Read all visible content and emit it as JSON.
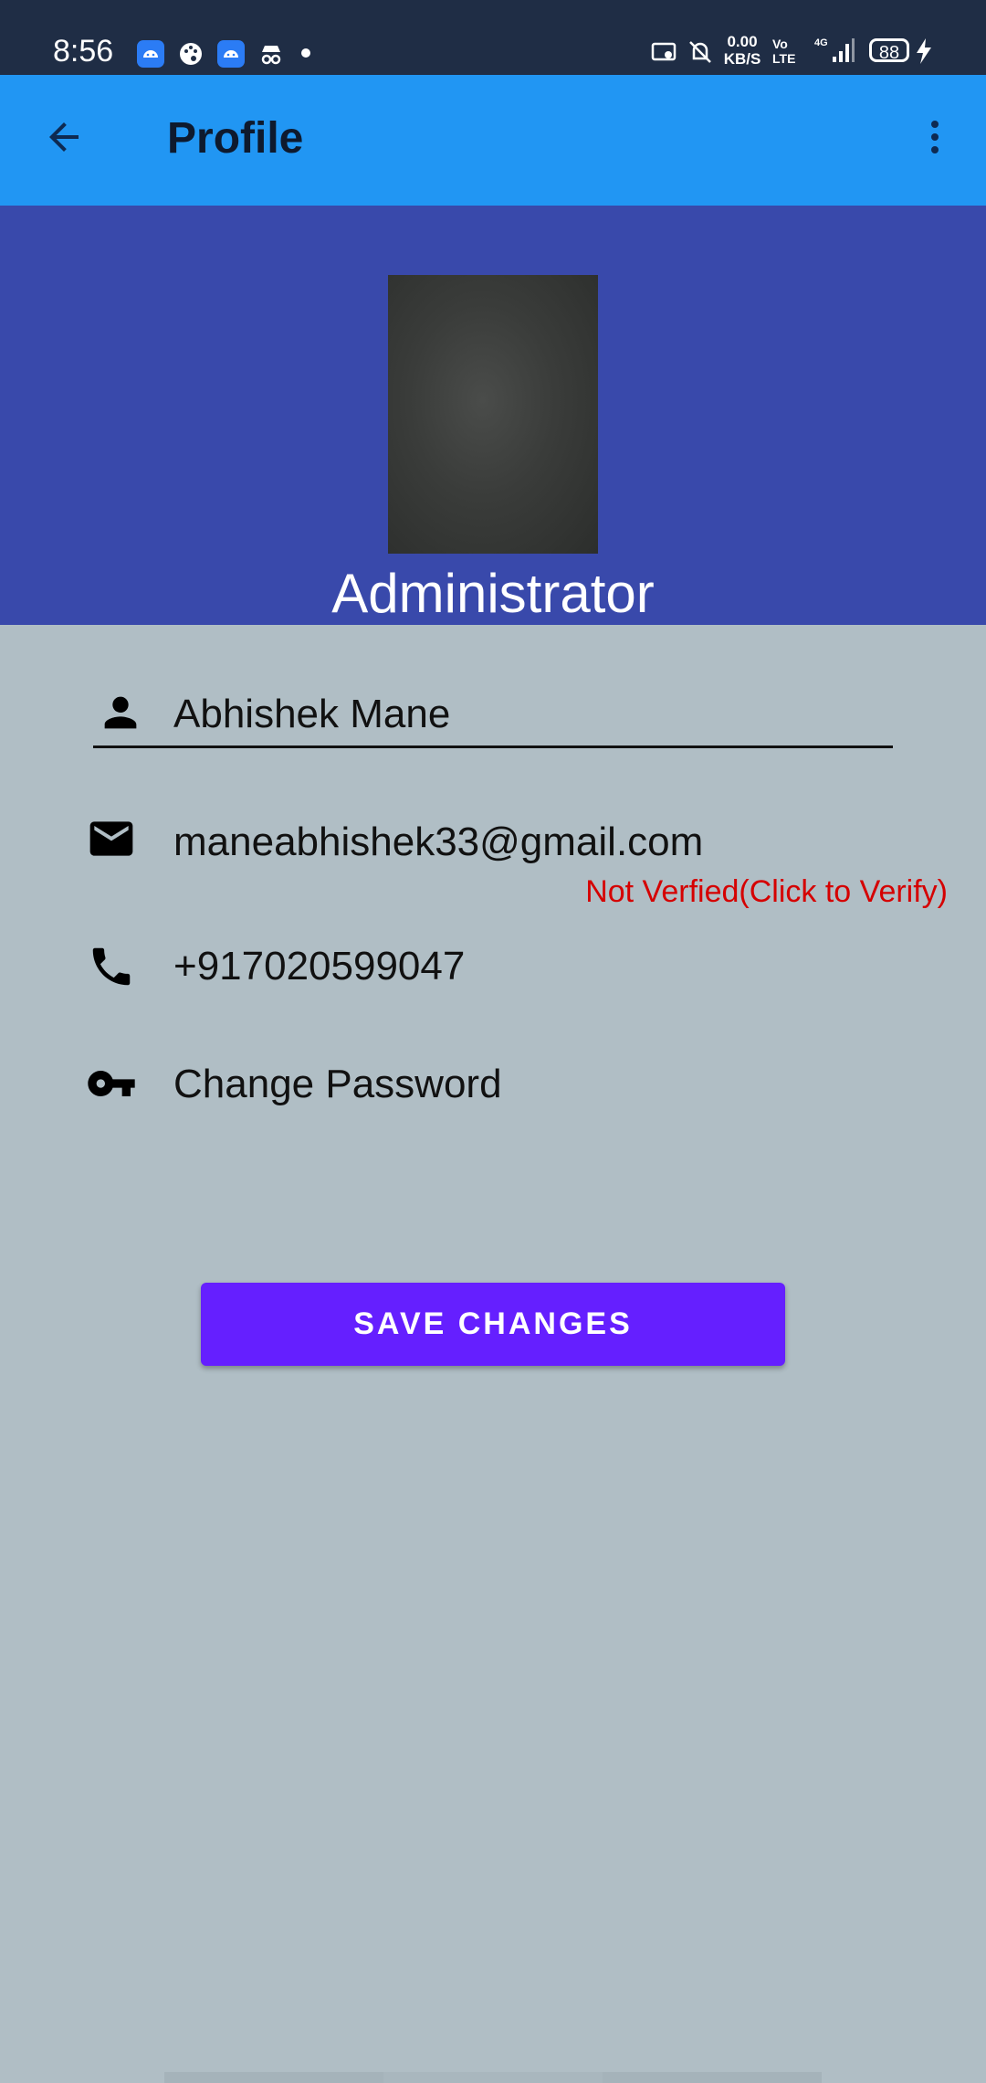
{
  "status_bar": {
    "time": "8:56",
    "net_speed_value": "0.00",
    "net_speed_unit": "KB/S",
    "volte_line1": "Vo",
    "volte_line2": "LTE",
    "battery_level": "88"
  },
  "app_bar": {
    "title": "Profile"
  },
  "profile": {
    "role": "Administrator",
    "name": "Abhishek Mane",
    "email": "maneabhishek33@gmail.com",
    "email_status": "Not Verfied(Click to Verify)",
    "phone": "+917020599047",
    "change_password_label": "Change Password"
  },
  "actions": {
    "save_label": "SAVE CHANGES"
  },
  "colors": {
    "status_bar": "#1f2d45",
    "app_bar": "#2196f3",
    "header_panel": "#3949ab",
    "page_background": "#b0bec5",
    "save_button": "#651fff",
    "unverified_text": "#d50000"
  },
  "icons": {
    "back": "arrow-back-icon",
    "more": "more-vert-icon",
    "name": "person-icon",
    "email": "mail-icon",
    "phone": "phone-icon",
    "password": "key-icon"
  }
}
